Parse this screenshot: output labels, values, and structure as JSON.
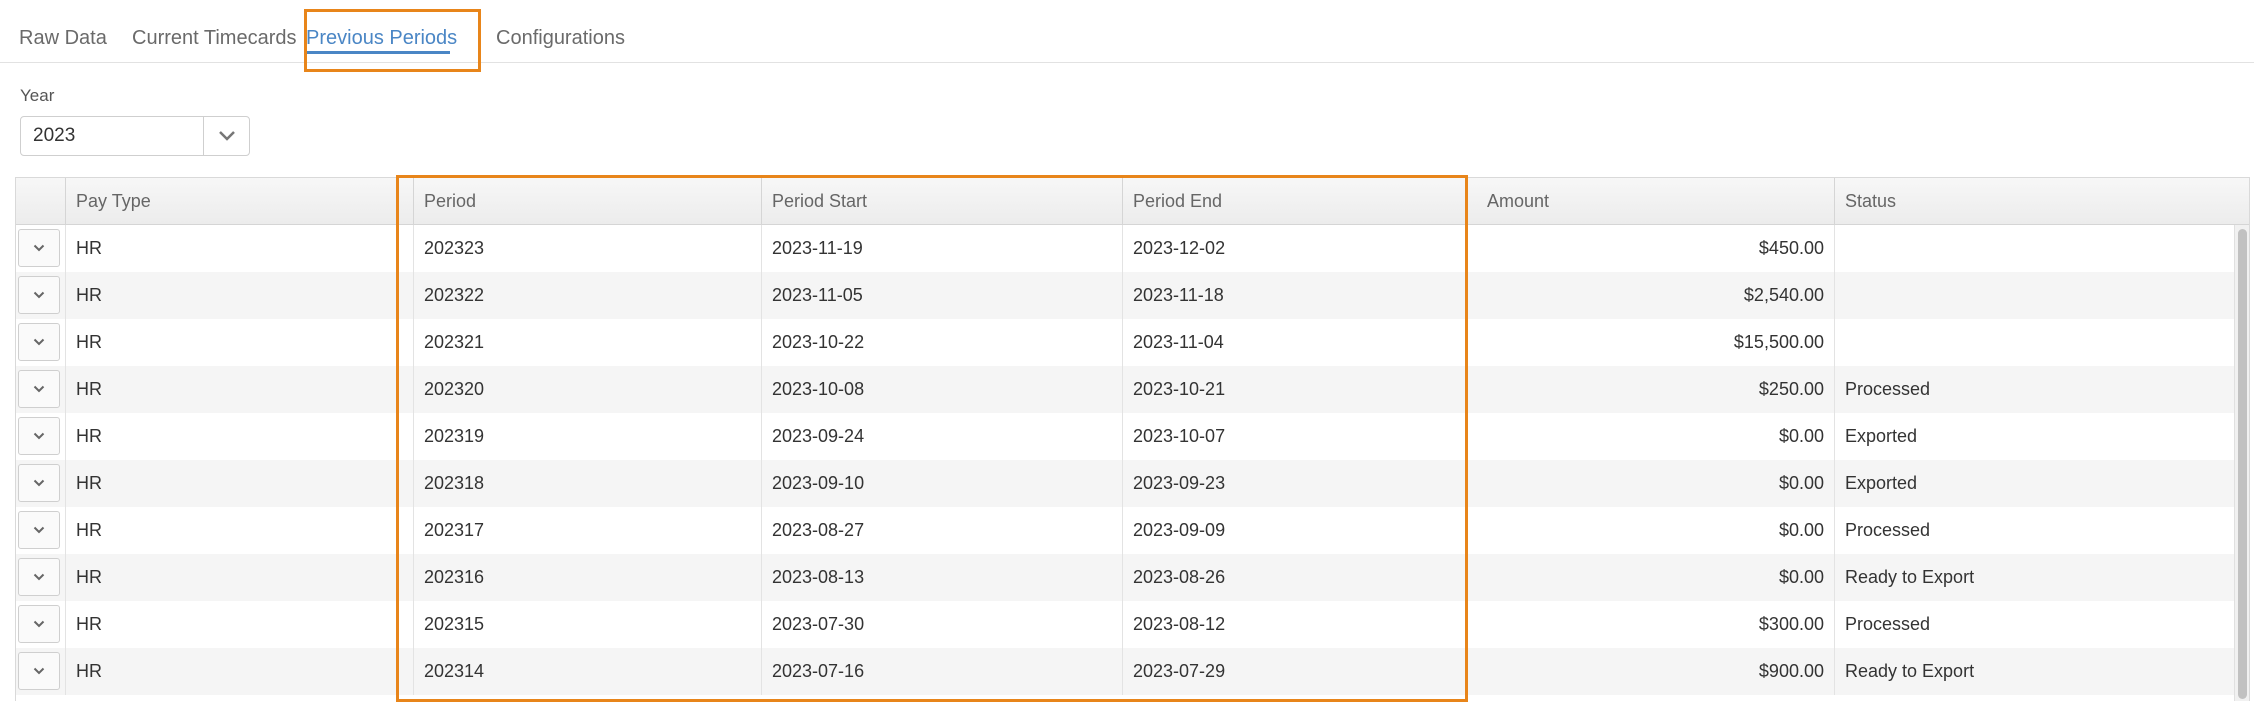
{
  "tabs": [
    {
      "label": "Raw Data"
    },
    {
      "label": "Current Timecards"
    },
    {
      "label": "Previous Periods"
    },
    {
      "label": "Configurations"
    }
  ],
  "filter": {
    "year_label": "Year",
    "year_value": "2023"
  },
  "table": {
    "columns": [
      "Pay Type",
      "Period",
      "Period Start",
      "Period End",
      "Amount",
      "Status"
    ],
    "rows": [
      {
        "pay_type": "HR",
        "period": "202323",
        "start": "2023-11-19",
        "end": "2023-12-02",
        "amount": "$450.00",
        "status": ""
      },
      {
        "pay_type": "HR",
        "period": "202322",
        "start": "2023-11-05",
        "end": "2023-11-18",
        "amount": "$2,540.00",
        "status": ""
      },
      {
        "pay_type": "HR",
        "period": "202321",
        "start": "2023-10-22",
        "end": "2023-11-04",
        "amount": "$15,500.00",
        "status": ""
      },
      {
        "pay_type": "HR",
        "period": "202320",
        "start": "2023-10-08",
        "end": "2023-10-21",
        "amount": "$250.00",
        "status": "Processed"
      },
      {
        "pay_type": "HR",
        "period": "202319",
        "start": "2023-09-24",
        "end": "2023-10-07",
        "amount": "$0.00",
        "status": "Exported"
      },
      {
        "pay_type": "HR",
        "period": "202318",
        "start": "2023-09-10",
        "end": "2023-09-23",
        "amount": "$0.00",
        "status": "Exported"
      },
      {
        "pay_type": "HR",
        "period": "202317",
        "start": "2023-08-27",
        "end": "2023-09-09",
        "amount": "$0.00",
        "status": "Processed"
      },
      {
        "pay_type": "HR",
        "period": "202316",
        "start": "2023-08-13",
        "end": "2023-08-26",
        "amount": "$0.00",
        "status": "Ready to Export"
      },
      {
        "pay_type": "HR",
        "period": "202315",
        "start": "2023-07-30",
        "end": "2023-08-12",
        "amount": "$300.00",
        "status": "Processed"
      },
      {
        "pay_type": "HR",
        "period": "202314",
        "start": "2023-07-16",
        "end": "2023-07-29",
        "amount": "$900.00",
        "status": "Ready to Export"
      }
    ]
  },
  "icons": {
    "row_expander": "chevron-down-icon",
    "year_dropdown": "chevron-down-icon"
  },
  "colors": {
    "accent": "#4a86c5",
    "highlight": "#e8851a"
  }
}
